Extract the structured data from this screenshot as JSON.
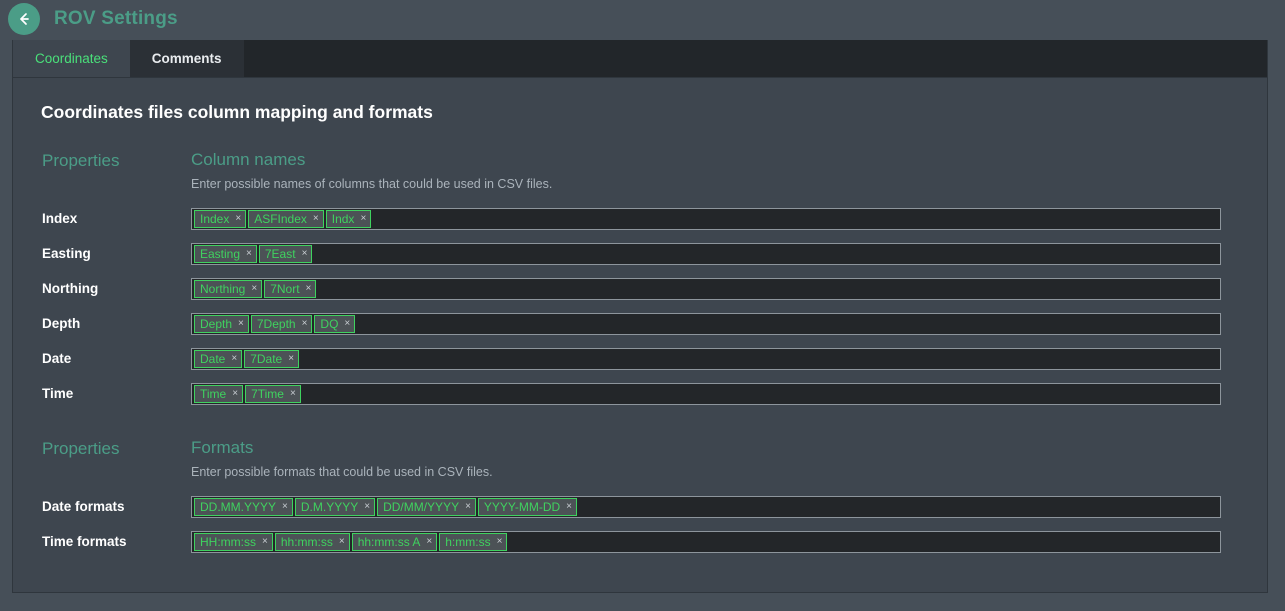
{
  "titlebar": {
    "back_icon": "arrow-left-icon",
    "title": "ROV Settings"
  },
  "tabs": [
    {
      "label": "Coordinates",
      "active": true
    },
    {
      "label": "Comments",
      "active": false
    }
  ],
  "page_heading": "Coordinates files column mapping and formats",
  "sections": [
    {
      "properties_label": "Properties",
      "title": "Column names",
      "description": "Enter possible names of columns that could be used in CSV files.",
      "rows": [
        {
          "label": "Index",
          "tags": [
            "Index",
            "ASFIndex",
            "Indx"
          ]
        },
        {
          "label": "Easting",
          "tags": [
            "Easting",
            "7East"
          ]
        },
        {
          "label": "Northing",
          "tags": [
            "Northing",
            "7Nort"
          ]
        },
        {
          "label": "Depth",
          "tags": [
            "Depth",
            "7Depth",
            "DQ"
          ]
        },
        {
          "label": "Date",
          "tags": [
            "Date",
            "7Date"
          ]
        },
        {
          "label": "Time",
          "tags": [
            "Time",
            "7Time"
          ]
        }
      ]
    },
    {
      "properties_label": "Properties",
      "title": "Formats",
      "description": "Enter possible formats that could be used in CSV files.",
      "rows": [
        {
          "label": "Date formats",
          "tags": [
            "DD.MM.YYYY",
            "D.M.YYYY",
            "DD/MM/YYYY",
            "YYYY-MM-DD"
          ]
        },
        {
          "label": "Time formats",
          "tags": [
            "HH:mm:ss",
            "hh:mm:ss",
            "hh:mm:ss A",
            "h:mm:ss"
          ]
        }
      ]
    }
  ],
  "tag_remove_glyph": "×",
  "colors": {
    "accent_teal": "#4b9d87",
    "tag_green": "#3fd25f",
    "active_tab_green": "#4ae07a",
    "panel_bg": "#3e464f",
    "window_bg": "#464f58",
    "input_bg": "#232629"
  }
}
